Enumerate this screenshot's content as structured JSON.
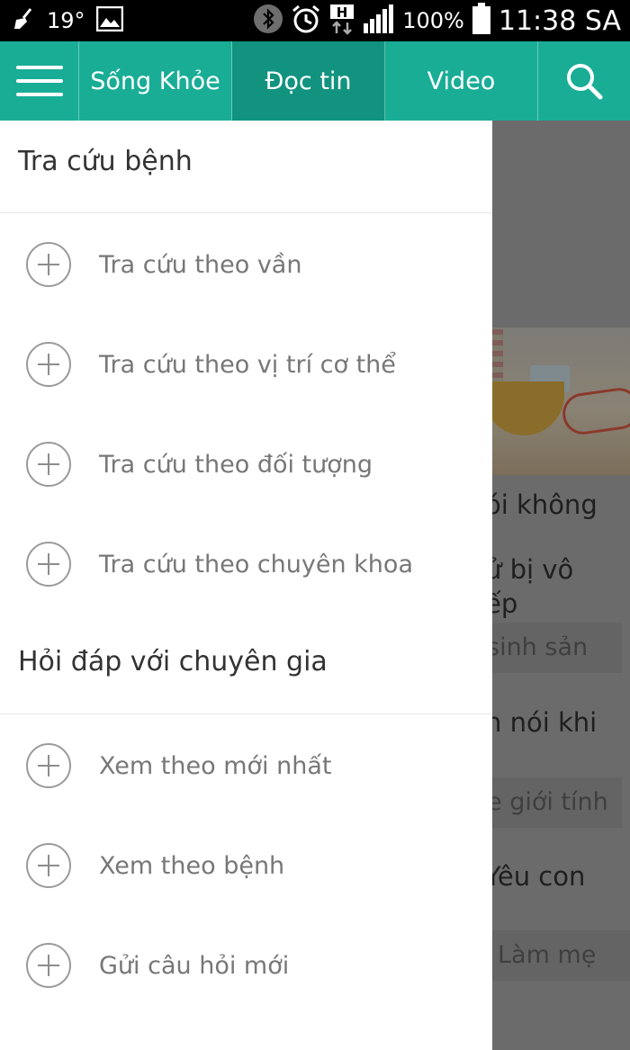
{
  "status_bar": {
    "temperature": "19°",
    "battery": "100%",
    "time": "11:38 SA",
    "network": "H",
    "icons": [
      "broom-icon",
      "image-icon",
      "bluetooth-icon",
      "alarm-icon",
      "hspa-icon",
      "signal-icon",
      "battery-icon"
    ]
  },
  "nav": {
    "tabs": [
      {
        "label": "Sống Khỏe"
      },
      {
        "label": "Đọc tin"
      },
      {
        "label": "Video"
      }
    ],
    "active_tab": "Đọc tin",
    "icons": [
      "menu-icon",
      "search-icon"
    ]
  },
  "drawer": {
    "sections": [
      {
        "title": "Tra cứu bệnh",
        "items": [
          {
            "label": "Tra cứu theo vần"
          },
          {
            "label": "Tra cứu theo vị trí cơ thể"
          },
          {
            "label": "Tra cứu theo đối tượng"
          },
          {
            "label": "Tra cứu theo chuyên khoa"
          }
        ]
      },
      {
        "title": "Hỏi đáp với chuyên gia",
        "items": [
          {
            "label": "Xem theo mới nhất"
          },
          {
            "label": "Xem theo bệnh"
          },
          {
            "label": "Gửi câu hỏi mới"
          }
        ]
      }
    ]
  },
  "background": {
    "lines": [
      "ói không",
      "ử bị vô",
      "ếp",
      "n nói khi",
      "Yêu con"
    ],
    "tags": [
      "sinh sản",
      "e giới tính",
      "Làm mẹ"
    ]
  },
  "colors": {
    "nav_bg": "#19ad96",
    "nav_active": "#11937f",
    "status_bg": "#000000",
    "drawer_bg": "#ffffff"
  }
}
